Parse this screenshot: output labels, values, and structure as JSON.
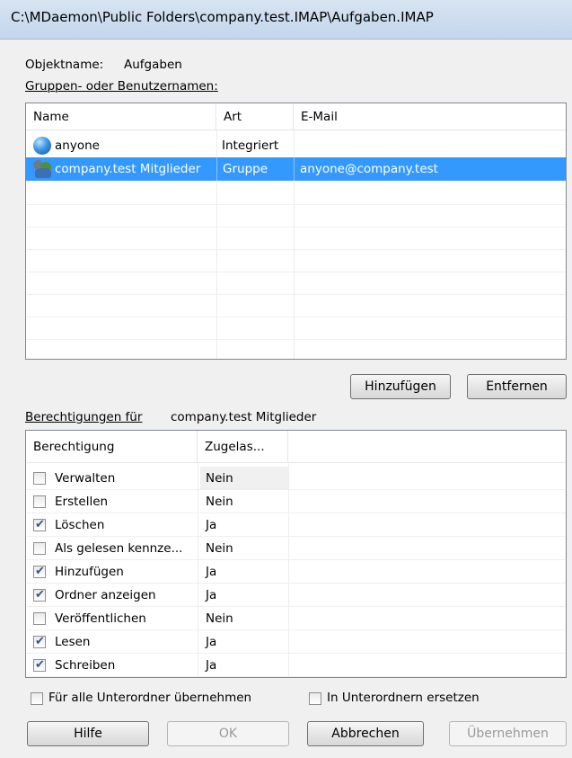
{
  "window": {
    "title": "C:\\MDaemon\\Public Folders\\company.test.IMAP\\Aufgaben.IMAP"
  },
  "object": {
    "label": "Objektname:",
    "value": "Aufgaben"
  },
  "users_label": "Gruppen- oder Benutzernamen:",
  "users": {
    "columns": [
      "Name",
      "Art",
      "E-Mail"
    ],
    "rows": [
      {
        "name": "anyone",
        "type": "Integriert",
        "email": "",
        "icon": "globe-icon"
      },
      {
        "name": "company.test Mitglieder",
        "type": "Gruppe",
        "email": "anyone@company.test",
        "icon": "group-icon",
        "selected": true
      }
    ]
  },
  "buttons": {
    "add": "Hinzufügen",
    "remove": "Entfernen",
    "help": "Hilfe",
    "ok": "OK",
    "cancel": "Abbrechen",
    "apply": "Übernehmen"
  },
  "permissions_for": {
    "label": "Berechtigungen für",
    "value": "company.test Mitglieder"
  },
  "permissions": {
    "columns": [
      "Berechtigung",
      "Zugelas..."
    ],
    "rows": [
      {
        "name": "Verwalten",
        "checked": false,
        "value": "Nein"
      },
      {
        "name": "Erstellen",
        "checked": false,
        "value": "Nein"
      },
      {
        "name": "Löschen",
        "checked": true,
        "value": "Ja"
      },
      {
        "name": "Als gelesen kennze...",
        "checked": false,
        "value": "Nein"
      },
      {
        "name": "Hinzufügen",
        "checked": true,
        "value": "Ja"
      },
      {
        "name": "Ordner anzeigen",
        "checked": true,
        "value": "Ja"
      },
      {
        "name": "Veröffentlichen",
        "checked": false,
        "value": "Nein"
      },
      {
        "name": "Lesen",
        "checked": true,
        "value": "Ja"
      },
      {
        "name": "Schreiben",
        "checked": true,
        "value": "Ja"
      }
    ]
  },
  "options": {
    "apply_subfolders": {
      "label": "Für alle Unterordner übernehmen",
      "checked": false
    },
    "replace_subfolders": {
      "label": "In Unterordnern ersetzen",
      "checked": false
    }
  },
  "colors": {
    "selection": "#3399ff",
    "titlebar": "#c9dbf0"
  }
}
